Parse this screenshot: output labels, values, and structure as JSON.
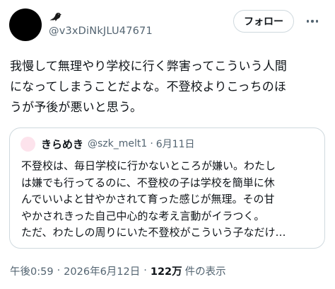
{
  "author": {
    "handle": "@v3xDiNkJLU47671"
  },
  "follow_button": {
    "label": "フォロー"
  },
  "more_menu": {
    "icon": "more-horizontal-icon"
  },
  "tweet": {
    "lines": [
      "我慢して無理やり学校に行く弊害ってこういう人間",
      "になってしまうことだよな。不登校よりこっちのほ",
      "うが予後が悪いと思う。"
    ]
  },
  "quote": {
    "name": "きらめき",
    "handle": "@szk_melt1",
    "separator": "·",
    "date": "6月11日",
    "lines": [
      "不登校は、毎日学校に行かないところが嫌い。わたし",
      "は嫌でも行ってるのに、不登校の子は学校を簡単に休",
      "んでいいよと甘やかされて育った感じが無理。その甘",
      "やかされきった自己中心的な考え言動がイラつく。",
      "ただ、わたしの周りにいた不登校がこういう子なだけ…"
    ]
  },
  "meta": {
    "time": "午後0:59",
    "separator": "·",
    "date": "2026年6月12日",
    "views_count": "122万",
    "views_label": "件の表示"
  },
  "colors": {
    "text_primary": "#0f1419",
    "text_secondary": "#536471",
    "border": "#cfd9de",
    "author_avatar": "#000000",
    "quote_avatar": "#fde3ec"
  }
}
